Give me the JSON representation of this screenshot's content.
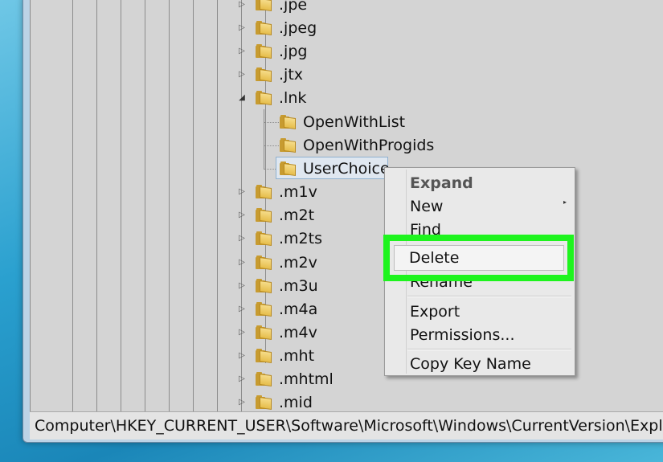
{
  "tree": {
    "top_items": [
      ".jpe",
      ".jpeg",
      ".jpg",
      ".jtx",
      ".lnk"
    ],
    "lnk_children": [
      "OpenWithList",
      "OpenWithProgids",
      "UserChoice"
    ],
    "bottom_items": [
      ".m1v",
      ".m2t",
      ".m2ts",
      ".m2v",
      ".m3u",
      ".m4a",
      ".m4v",
      ".mht",
      ".mhtml",
      ".mid"
    ]
  },
  "context_menu": {
    "expand": "Expand",
    "new": "New",
    "find": "Find",
    "delete": "Delete",
    "rename": "Rename",
    "export": "Export",
    "permissions": "Permissions...",
    "copy_key_name": "Copy Key Name"
  },
  "status_bar": {
    "path": "Computer\\HKEY_CURRENT_USER\\Software\\Microsoft\\Windows\\CurrentVersion\\Explor"
  },
  "colors": {
    "highlight": "#1ef41e",
    "folder": "#e6bd4b"
  }
}
